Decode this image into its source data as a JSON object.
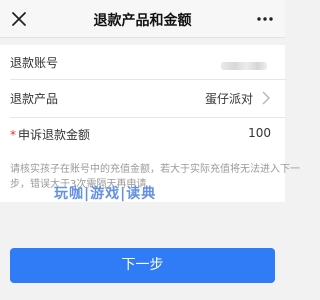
{
  "nav": {
    "title": "退款产品和金额",
    "close_icon": "close-icon",
    "more_icon": "more-dots-icon"
  },
  "form": {
    "account": {
      "label": "退款账号",
      "value_obscured": true
    },
    "product": {
      "label": "退款产品",
      "value": "蛋仔派对",
      "icon": "chevron-right-icon"
    },
    "amount": {
      "required_mark": "*",
      "label": "申诉退款金额",
      "value": "100"
    }
  },
  "hint": "请核实孩子在账号中的充值金额，若大于实际充值将无法进入下一步，错误大于3次需隔天再申请",
  "watermark": "玩咖|游戏|读典",
  "next_button": {
    "label": "下一步"
  },
  "colors": {
    "accent": "#2f7cf6",
    "required": "#e0342c",
    "hint": "#9a9a9a"
  }
}
